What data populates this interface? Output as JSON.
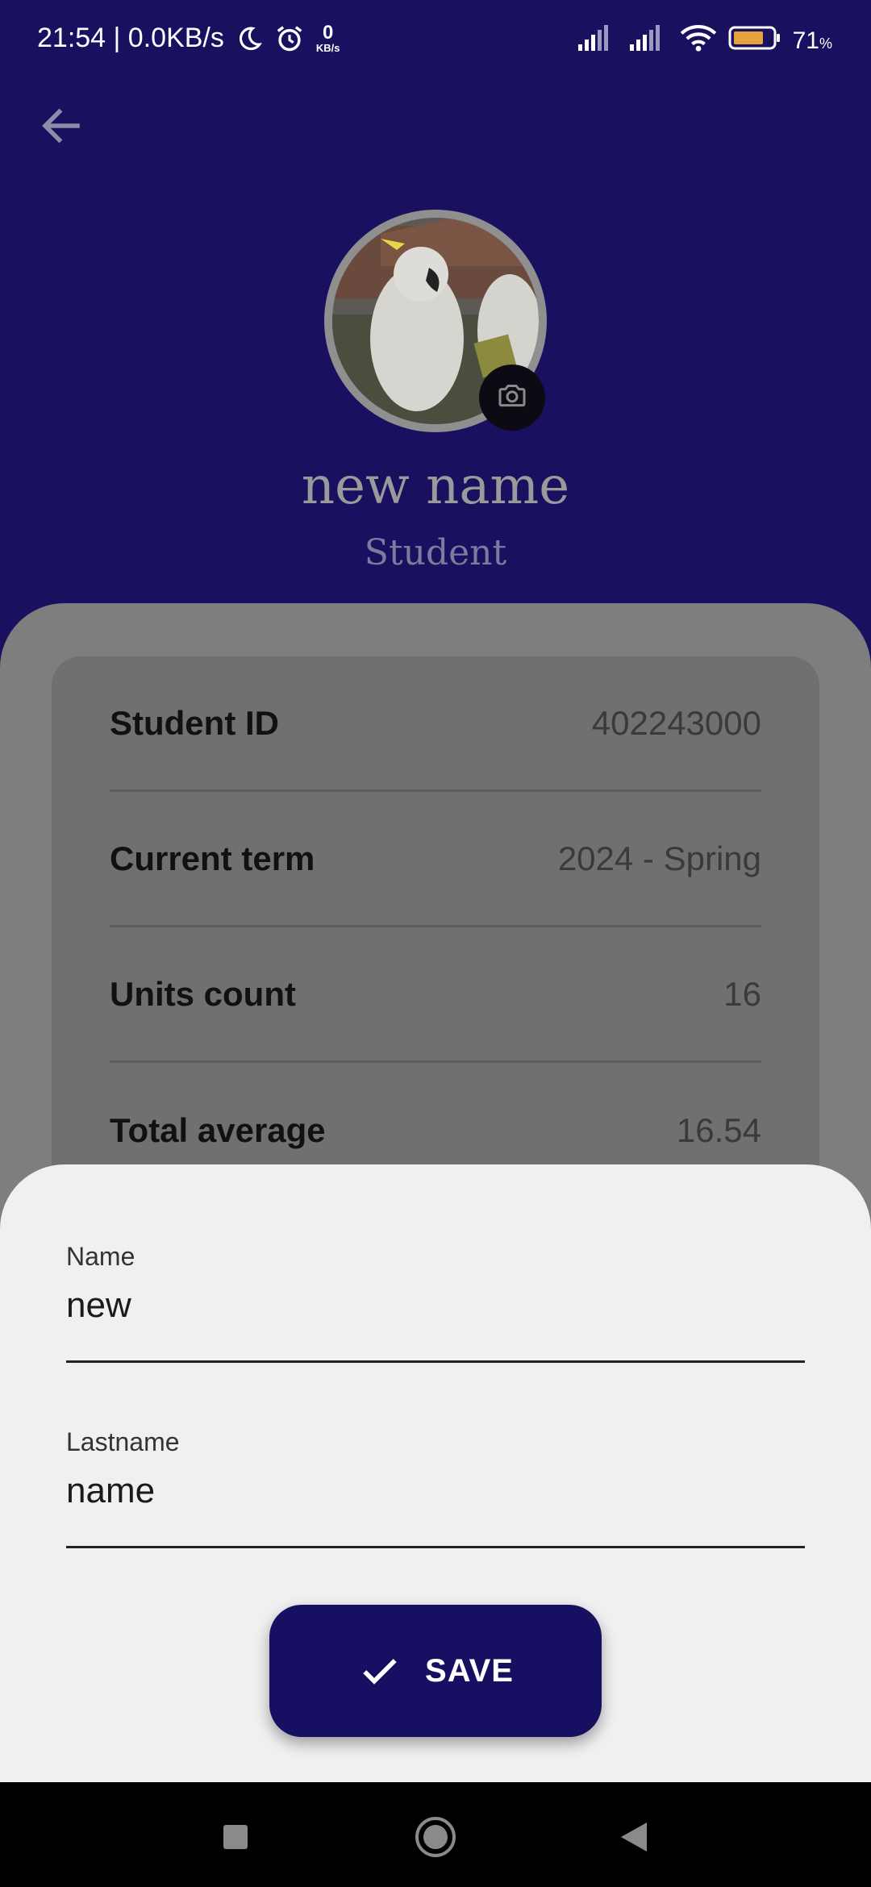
{
  "status_bar": {
    "time_speed": "21:54 | 0.0KB/s",
    "kbs_num": "0",
    "kbs_unit": "KB/s",
    "battery_percent": "71",
    "battery_percent_unit": "%"
  },
  "profile": {
    "name": "new name",
    "role": "Student"
  },
  "details": [
    {
      "label": "Student ID",
      "value": "402243000"
    },
    {
      "label": "Current term",
      "value": "2024 - Spring"
    },
    {
      "label": "Units count",
      "value": "16"
    },
    {
      "label": "Total average",
      "value": "16.54"
    }
  ],
  "edit_form": {
    "name_label": "Name",
    "name_value": "new",
    "lastname_label": "Lastname",
    "lastname_value": "name",
    "save_label": "SAVE"
  },
  "icons": {
    "back": "arrow-left-icon",
    "camera": "camera-icon",
    "check": "check-icon",
    "moon": "moon-icon",
    "alarm": "alarm-icon",
    "signal": "signal-icon",
    "wifi": "wifi-icon",
    "battery": "battery-icon",
    "nav_recents": "square-icon",
    "nav_home": "circle-icon",
    "nav_back": "triangle-back-icon"
  },
  "colors": {
    "header_bg": "#1a1060",
    "save_button_bg": "#170f62",
    "sheet_bg": "#f0f0f0",
    "battery_fill": "#e6a23c"
  }
}
